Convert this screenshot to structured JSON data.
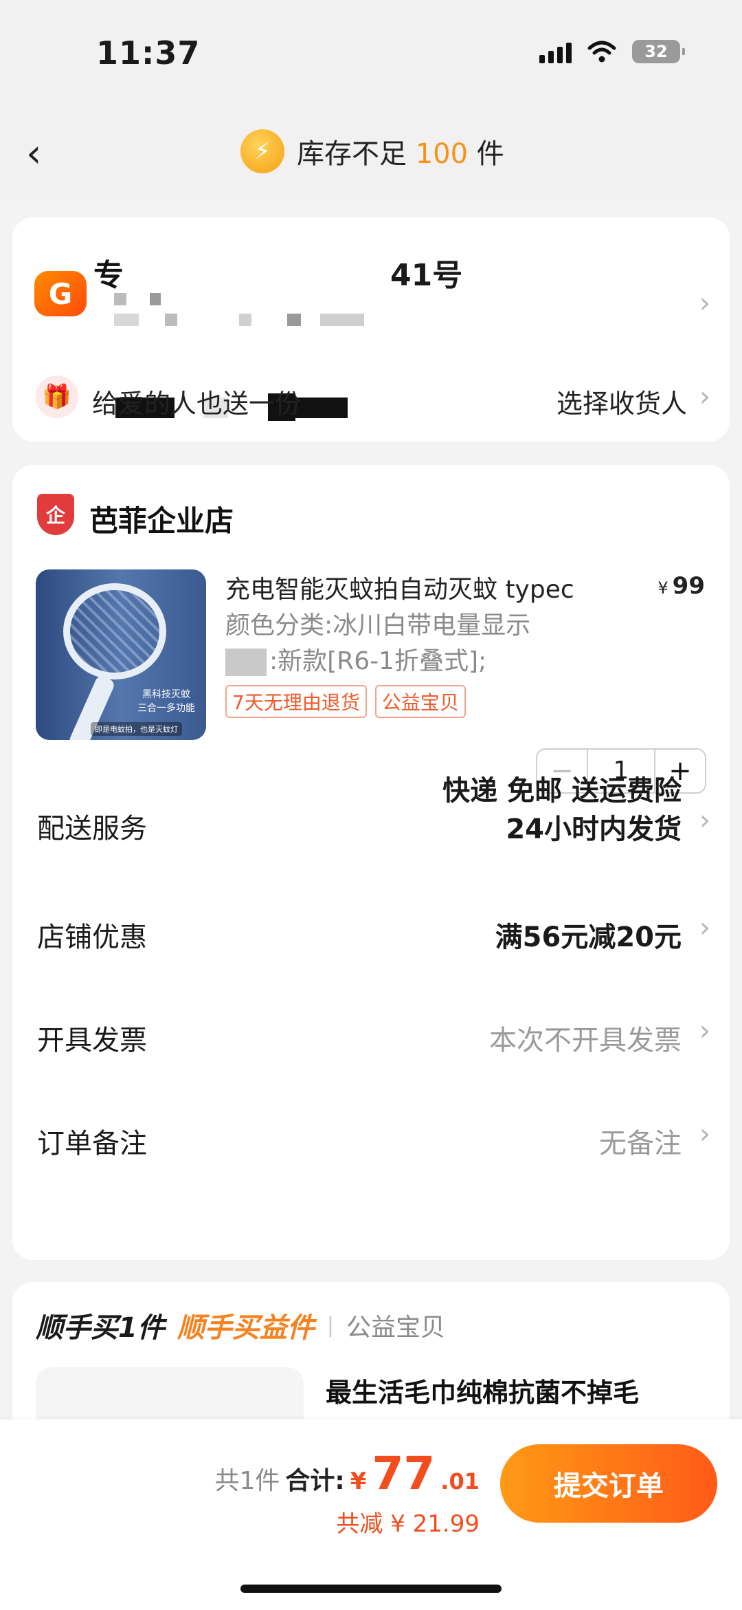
{
  "status_bar": {
    "time": "11:37",
    "battery": "32"
  },
  "nav": {
    "title_prefix": "库存不足",
    "title_number": "100",
    "title_suffix": "件"
  },
  "address": {
    "line1_start": "专",
    "line1_end": "41号",
    "gift_text": "给爱的人也送一份",
    "gift_action": "选择收货人"
  },
  "shop": {
    "name": "芭菲企业店",
    "icon_label": "企"
  },
  "product": {
    "title": "充电智能灭蚊拍自动灭蚊 typec",
    "price_symbol": "¥",
    "price": "99",
    "spec_line1": "颜色分类:冰川白带电量显示",
    "spec_line2": ":新款[R6-1折叠式];",
    "tags": [
      "7天无理由退货",
      "公益宝贝"
    ],
    "quantity": "1",
    "image_caption_1": "黑科技灭蚊",
    "image_caption_2": "三合一多功能",
    "image_note": "即是电蚊拍，也是灭蚊灯"
  },
  "rows": {
    "delivery_label": "配送服务",
    "delivery_value_1": "快递 免邮 送运费险",
    "delivery_value_2": "24小时内发货",
    "coupon_label": "店铺优惠",
    "coupon_value": "满56元减20元",
    "invoice_label": "开具发票",
    "invoice_value": "本次不开具发票",
    "note_label": "订单备注",
    "note_value": "无备注"
  },
  "addon": {
    "title_black": "顺手买1件",
    "title_orange": "顺手买益件",
    "subtitle": "公益宝贝",
    "item_title": "最生活毛巾纯棉抗菌不掉毛"
  },
  "footer": {
    "count_text": "共1件",
    "total_label": "合计:",
    "currency": "¥",
    "amount_int": "77",
    "amount_dec": ".01",
    "discount_text": "共减 ¥ 21.99",
    "submit_label": "提交订单"
  },
  "colors": {
    "accent": "#f5821f",
    "price_red": "#f24d1e",
    "button_start": "#ff9a16",
    "button_end": "#ff5a18"
  }
}
